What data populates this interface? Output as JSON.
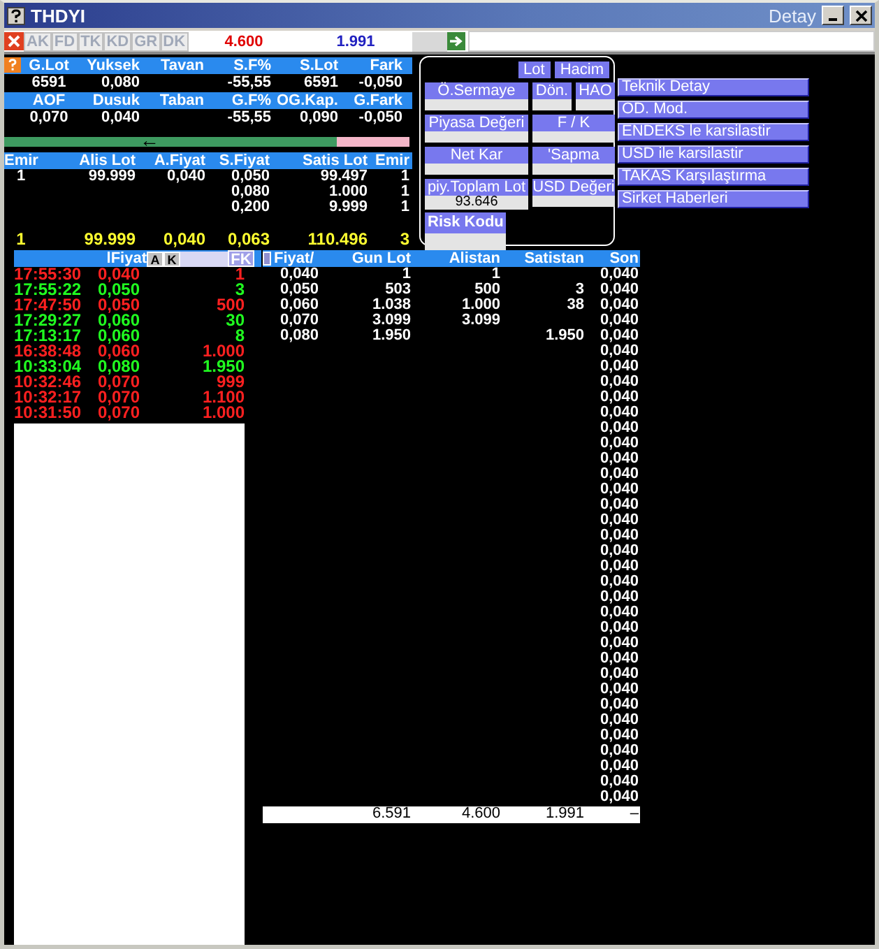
{
  "window": {
    "title": "THDYI",
    "subtitle": "Detay"
  },
  "toolbar": {
    "tabs": [
      "AK",
      "FD",
      "TK",
      "KD",
      "GR",
      "DK"
    ],
    "field_1": "4.600",
    "field_2": "1.991"
  },
  "quote": [
    {
      "cells": [
        {
          "header": "G.Lot",
          "value": "6591"
        },
        {
          "header": "Yuksek",
          "value": "0,080"
        },
        {
          "header": "Tavan"
        },
        {
          "header": "S.F%",
          "value": "-55,55"
        },
        {
          "header": "S.Lot",
          "value": "6591"
        },
        {
          "header": "Fark",
          "value": "-0,050"
        }
      ]
    },
    {
      "cells": [
        {
          "header": "AOF",
          "value": "0,070"
        },
        {
          "header": "Dusuk",
          "value": "0,040"
        },
        {
          "header": "Taban"
        },
        {
          "header": "G.F%",
          "value": "-55,55"
        },
        {
          "header": "OG.Kap.",
          "value": "0,090"
        },
        {
          "header": "G.Fark",
          "value": "-0,050"
        }
      ]
    }
  ],
  "balance_bar": {
    "level": 0.82,
    "arrow": "←"
  },
  "order_book": {
    "columns": [
      "Emir",
      "Alis Lot",
      "A.Fiyat",
      "S.Fiyat",
      "Satis Lot",
      "Emir"
    ],
    "rows": [
      {
        "buy_orders": "1",
        "buy_lot": "99.999",
        "buy_price": "0,040",
        "sell_price": "0,050",
        "sell_lot": "99.497",
        "sell_orders": "1"
      },
      {
        "sell_price": "0,080",
        "sell_lot": "1.000",
        "sell_orders": "1"
      },
      {
        "sell_price": "0,200",
        "sell_lot": "9.999",
        "sell_orders": "1"
      }
    ],
    "totals": {
      "buy_orders": "1",
      "buy_lot": "99.999",
      "buy_price": "0,040",
      "sell_price": "0,063",
      "sell_lot": "110.496",
      "sell_orders": "3"
    }
  },
  "info_panel": {
    "tabs": [
      {
        "label": "Lot",
        "selected": false
      },
      {
        "label": "Hacim",
        "selected": false
      }
    ],
    "fields": [
      {
        "label": "Ö.Sermaye"
      },
      {
        "label": "Dön."
      },
      {
        "label": "HAO"
      },
      {
        "label": "Piyasa Değeri"
      },
      {
        "label": "F / K"
      },
      {
        "label": "Net Kar"
      },
      {
        "label": "'Sapma"
      },
      {
        "label": "piy.Toplam Lot",
        "value": "93.646"
      },
      {
        "label": "USD Değeri"
      }
    ],
    "risk_label": "Risk Kodu"
  },
  "menu": [
    "Teknik Detay",
    "OD. Mod.",
    "ENDEKS le karsilastir",
    "USD ile karsilastir",
    "TAKAS Karşılaştırma",
    "Sirket Haberleri"
  ],
  "trades": {
    "header": "lFiyat",
    "buttons": [
      "A",
      "K",
      "FK"
    ],
    "rows": [
      {
        "time": "17:55:30",
        "price": "0,040",
        "lot": "1",
        "color": "#ff2020"
      },
      {
        "time": "17:55:22",
        "price": "0,050",
        "lot": "3",
        "color": "#20ff20"
      },
      {
        "time": "17:47:50",
        "price": "0,050",
        "lot": "500",
        "color": "#ff2020"
      },
      {
        "time": "17:29:27",
        "price": "0,060",
        "lot": "30",
        "color": "#20ff20"
      },
      {
        "time": "17:13:17",
        "price": "0,060",
        "lot": "8",
        "color": "#20ff20"
      },
      {
        "time": "16:38:48",
        "price": "0,060",
        "lot": "1.000",
        "color": "#ff2020"
      },
      {
        "time": "10:33:04",
        "price": "0,080",
        "lot": "1.950",
        "color": "#20ff20"
      },
      {
        "time": "10:32:46",
        "price": "0,070",
        "lot": "999",
        "color": "#ff2020"
      },
      {
        "time": "10:32:17",
        "price": "0,070",
        "lot": "1.100",
        "color": "#ff2020"
      },
      {
        "time": "10:31:50",
        "price": "0,070",
        "lot": "1.000",
        "color": "#ff2020"
      }
    ]
  },
  "price_table": {
    "columns": [
      "Fiyat/",
      "Gun Lot",
      "Alistan",
      "Satistan",
      "Son"
    ],
    "rows": [
      {
        "fiyat": "0,040",
        "gun_lot": "1",
        "alistan": "1",
        "son": "0,040"
      },
      {
        "fiyat": "0,050",
        "gun_lot": "503",
        "alistan": "500",
        "satistan": "3",
        "son": "0,040"
      },
      {
        "fiyat": "0,060",
        "gun_lot": "1.038",
        "alistan": "1.000",
        "satistan": "38",
        "son": "0,040"
      },
      {
        "fiyat": "0,070",
        "gun_lot": "3.099",
        "alistan": "3.099",
        "son": "0,040"
      },
      {
        "fiyat": "0,080",
        "gun_lot": "1.950",
        "satistan": "1.950",
        "son": "0,040"
      },
      {
        "son": "0,040"
      },
      {
        "son": "0,040"
      },
      {
        "son": "0,040"
      },
      {
        "son": "0,040"
      },
      {
        "son": "0,040"
      },
      {
        "son": "0,040"
      },
      {
        "son": "0,040"
      },
      {
        "son": "0,040"
      },
      {
        "son": "0,040"
      },
      {
        "son": "0,040"
      },
      {
        "son": "0,040"
      },
      {
        "son": "0,040"
      },
      {
        "son": "0,040"
      },
      {
        "son": "0,040"
      },
      {
        "son": "0,040"
      },
      {
        "son": "0,040"
      },
      {
        "son": "0,040"
      },
      {
        "son": "0,040"
      },
      {
        "son": "0,040"
      },
      {
        "son": "0,040"
      },
      {
        "son": "0,040"
      },
      {
        "son": "0,040"
      },
      {
        "son": "0,040"
      },
      {
        "son": "0,040"
      },
      {
        "son": "0,040"
      },
      {
        "son": "0,040"
      },
      {
        "son": "0,040"
      },
      {
        "son": "0,040"
      },
      {
        "son": "0,040"
      },
      {
        "son": "0,040"
      }
    ],
    "totals": {
      "gun_lot": "6.591",
      "alistan": "4.600",
      "satistan": "1.991",
      "son": "–"
    }
  }
}
